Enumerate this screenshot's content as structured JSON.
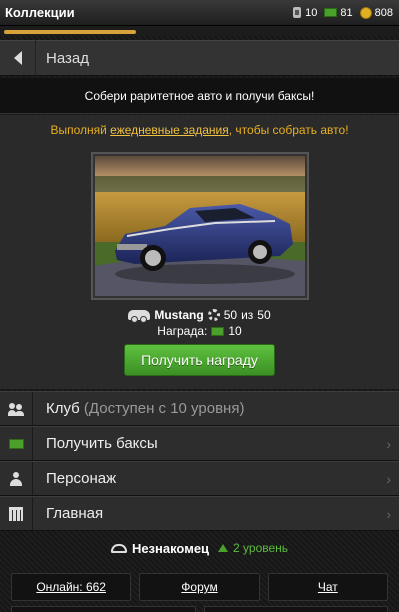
{
  "header": {
    "title": "Коллекции",
    "energy": "10",
    "money": "81",
    "gold": "808"
  },
  "progress": {
    "fraction": 0.33
  },
  "back": {
    "label": "Назад"
  },
  "headline": "Собери раритетное авто и получи баксы!",
  "task": {
    "before": "Выполняй ",
    "link": "ежедневные задания",
    "after": ", чтобы собрать авто!"
  },
  "car": {
    "name": "Mustang",
    "parts_current": "50",
    "parts_separator": "из",
    "parts_total": "50",
    "reward_label": "Награда:",
    "reward_value": "10"
  },
  "reward_button": "Получить награду",
  "menu": [
    {
      "icon": "people-icon",
      "label": "Клуб",
      "note": "(Доступен с 10 уровня)",
      "chevron": ""
    },
    {
      "icon": "money-icon",
      "label": "Получить баксы",
      "note": "",
      "chevron": "›"
    },
    {
      "icon": "person-icon",
      "label": "Персонаж",
      "note": "",
      "chevron": "›"
    },
    {
      "icon": "calendar-icon",
      "label": "Главная",
      "note": "",
      "chevron": "›"
    }
  ],
  "user": {
    "name": "Незнакомец",
    "level": "2 уровень"
  },
  "links": {
    "online": "Онлайн: 662",
    "forum": "Форум",
    "chat": "Чат"
  },
  "colors": {
    "accent_orange": "#d8a23a",
    "button_green": "#4aa02a",
    "task_text": "#e8b020"
  }
}
